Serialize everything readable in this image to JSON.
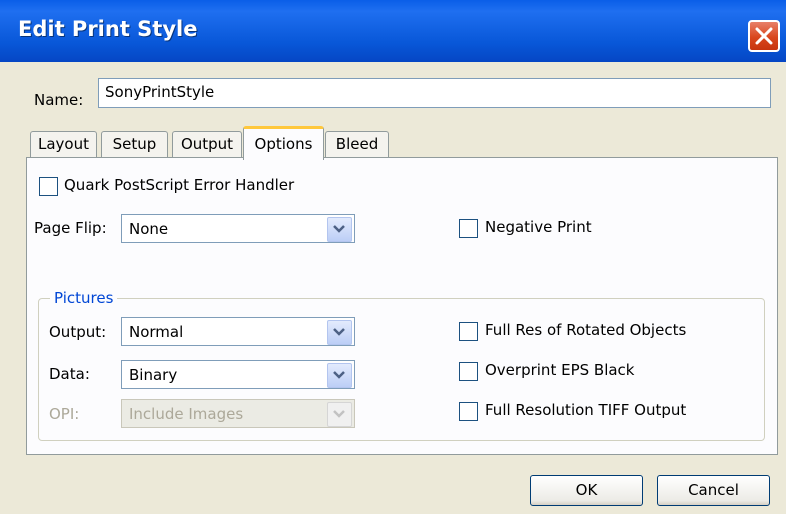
{
  "dialog": {
    "title": "Edit Print Style",
    "close_icon": "close-icon"
  },
  "name": {
    "label": "Name:",
    "value": "SonyPrintStyle"
  },
  "tabs": [
    {
      "label": "Layout",
      "active": false
    },
    {
      "label": "Setup",
      "active": false
    },
    {
      "label": "Output",
      "active": false
    },
    {
      "label": "Options",
      "active": true
    },
    {
      "label": "Bleed",
      "active": false
    }
  ],
  "options": {
    "error_handler": {
      "label": "Quark PostScript Error Handler",
      "checked": false
    },
    "page_flip": {
      "label": "Page Flip:",
      "value": "None"
    },
    "negative_print": {
      "label": "Negative Print",
      "checked": false
    }
  },
  "pictures": {
    "legend": "Pictures",
    "output": {
      "label": "Output:",
      "value": "Normal"
    },
    "data": {
      "label": "Data:",
      "value": "Binary"
    },
    "opi": {
      "label": "OPI:",
      "value": "Include Images",
      "disabled": true
    },
    "full_res_rotated": {
      "label": "Full Res of Rotated Objects",
      "checked": false
    },
    "overprint_eps": {
      "label": "Overprint EPS Black",
      "checked": false
    },
    "full_res_tiff": {
      "label": "Full Resolution TIFF Output",
      "checked": false
    }
  },
  "buttons": {
    "ok": "OK",
    "cancel": "Cancel"
  },
  "colors": {
    "titlebar": "#0a5ee8",
    "dialog_bg": "#ece9d8",
    "panel_bg": "#fcfcfe",
    "group_label": "#0046d5",
    "close_btn": "#d9461d"
  }
}
